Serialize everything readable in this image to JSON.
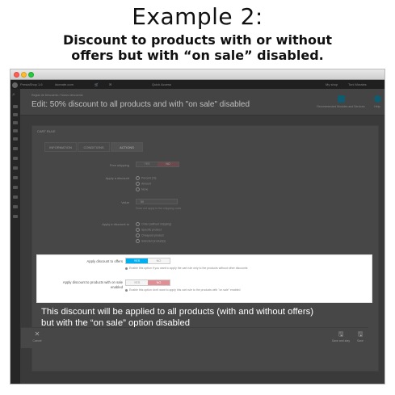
{
  "headline": "Example 2:",
  "subhead_line1": "Discount to products with or without",
  "subhead_line2": "offers but with “on sale” disabled.",
  "topbar": {
    "brand": "PrestaShop 1.6",
    "shop_url": "idcreate.com",
    "quick_access": "Quick Access",
    "my_shop": "My shop",
    "user": "Toni Morales"
  },
  "header": {
    "breadcrumb": "Reglas de Descuento  /  Nuevo descuento",
    "title": "Edit: 50% discount to all products and with \"on sale\" disabled",
    "recommended_label": "Recommended Modules and Services",
    "help_label": "Help"
  },
  "panel": {
    "heading": "CART RULE",
    "tabs": [
      {
        "label": "INFORMATION"
      },
      {
        "label": "CONDITIONS"
      },
      {
        "label": "ACTIONS"
      }
    ],
    "free_shipping_label": "Free shipping",
    "free_shipping_yes": "YES",
    "free_shipping_no": "NO",
    "apply_discount_label": "Apply a discount",
    "apply_discount_options": [
      "Percent (%)",
      "Amount",
      "None"
    ],
    "value_label": "Value",
    "value_input": "50",
    "value_hint": "Does not apply to the shipping costs",
    "apply_to_label": "Apply a discount to",
    "apply_to_options": [
      "Order (without shipping)",
      "Specific product",
      "Cheapest product",
      "Selected product(s)"
    ]
  },
  "card": {
    "offers_label": "Apply discount to offers",
    "offers_yes": "YES",
    "offers_no": "NO",
    "offers_hint": "Enable this option if you want to apply the cart rule only to the products without other discounts",
    "onsale_label_line1": "Apply discount to products with on sale",
    "onsale_label_line2": "enabled",
    "onsale_yes": "YES",
    "onsale_no": "NO",
    "onsale_hint": "Enable this option don't want to apply this cart rule to the products with \"on sale\" enabled"
  },
  "overlay": {
    "line1": "This discount will be applied to all products (with and without offers)",
    "line2": "but with the “on sale” option disabled"
  },
  "footer": {
    "cancel_label": "Cancel",
    "save_stay_label": "Save and stay",
    "save_label": "Save"
  },
  "colors": {
    "yes_active": "#00aff0",
    "no_active": "#e08f95",
    "window_dark": "#3a3a3a"
  }
}
